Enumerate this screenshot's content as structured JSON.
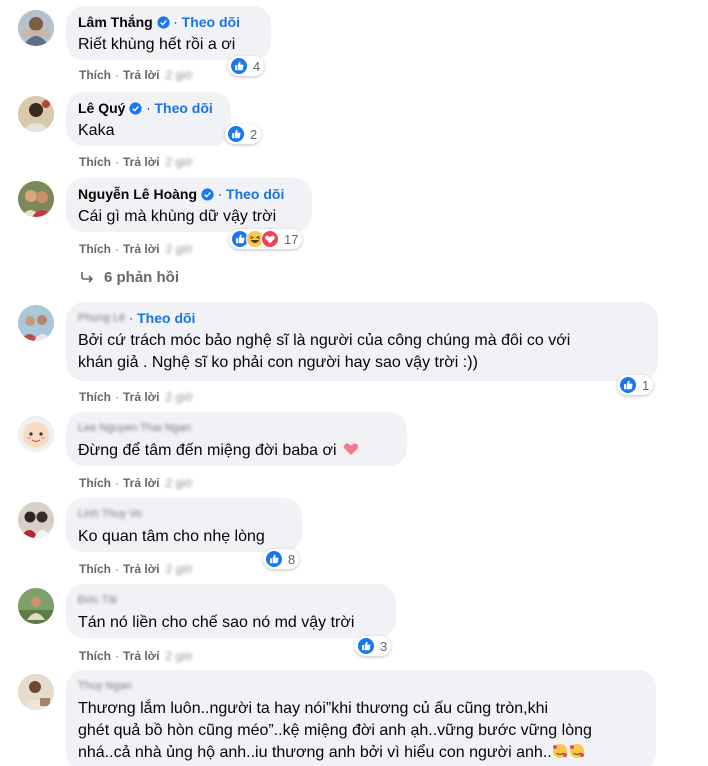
{
  "actions": {
    "like": "Thích",
    "reply": "Trả lời",
    "sep": "·",
    "time": "2 giờ"
  },
  "view_replies": "6 phản hồi",
  "comments": [
    {
      "name": "Lâm Thắng",
      "verified": true,
      "follow": "Theo dõi",
      "text": [
        "Riết khùng hết rồi a ơi"
      ],
      "reactions": [
        "like"
      ],
      "count": "4"
    },
    {
      "name": "Lê Quý",
      "verified": true,
      "follow": "Theo dõi",
      "text": [
        "Kaka"
      ],
      "reactions": [
        "like"
      ],
      "count": "2"
    },
    {
      "name": "Nguyễn Lê Hoàng",
      "verified": true,
      "follow": "Theo dõi",
      "text": [
        "Cái gì mà khùng dữ vậy trời"
      ],
      "reactions": [
        "like",
        "haha",
        "love"
      ],
      "count": "17"
    },
    {
      "name": "Phụng Lê",
      "blurred": true,
      "follow": "Theo dõi",
      "text": [
        "Bởi cứ trách móc bảo nghệ sĩ là người của công chúng mà đôi co với",
        "khán giả . Nghệ sĩ ko phải con người hay sao vậy trời :))"
      ],
      "reactions": [
        "like"
      ],
      "count": "1"
    },
    {
      "name": "Lee Nguyen Thai Ngan",
      "blurred": true,
      "text": [
        "Đừng để tâm đến miệng đời baba ơi"
      ],
      "emoji": "heart"
    },
    {
      "name": "Linh Thuy Vo",
      "blurred": true,
      "text": [
        "Ko quan tâm cho nhẹ lòng"
      ],
      "reactions": [
        "like"
      ],
      "count": "8"
    },
    {
      "name": "Đức Tài",
      "blurred": true,
      "text": [
        "Tán nó liền cho chế sao nó md vậy trời"
      ],
      "reactions": [
        "like"
      ],
      "count": "3"
    },
    {
      "name": "Thuy Ngan",
      "blurred": true,
      "text": [
        "Thương lắm luôn..người ta hay nói”khi thương củ ấu cũng tròn,khi",
        "ghét quả bồ hòn cũng méo”..kệ miệng đời anh ạh..vững bước vững lòng",
        "nhá..cả nhà ủng hộ anh..iu thương anh bởi vì hiểu con người anh.."
      ],
      "emoji": "smiling-face-with-hearts"
    }
  ],
  "colors": {
    "bubble": "#f0f2f5",
    "link": "#1b74e4",
    "meta": "#65676b",
    "like": "#1877f2"
  }
}
